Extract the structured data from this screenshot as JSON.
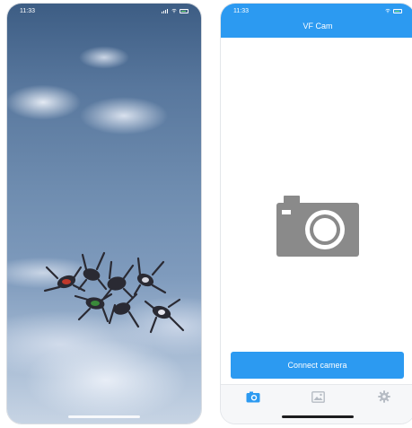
{
  "colors": {
    "accent": "#2c9af1",
    "camera_icon_gray": "#8a8a8a",
    "tab_inactive": "#b6bcc4"
  },
  "splash_screen": {
    "status_bar": {
      "time": "11:33"
    },
    "background": "sky-with-skydivers-image"
  },
  "app_screen": {
    "status_bar": {
      "time": "11:33"
    },
    "header": {
      "title": "VF Cam"
    },
    "placeholder_icon": "camera-icon",
    "connect_button_label": "Connect camera",
    "tabs": [
      {
        "icon": "camera-tab-icon",
        "active": true
      },
      {
        "icon": "gallery-tab-icon",
        "active": false
      },
      {
        "icon": "settings-gear-icon",
        "active": false
      }
    ]
  }
}
